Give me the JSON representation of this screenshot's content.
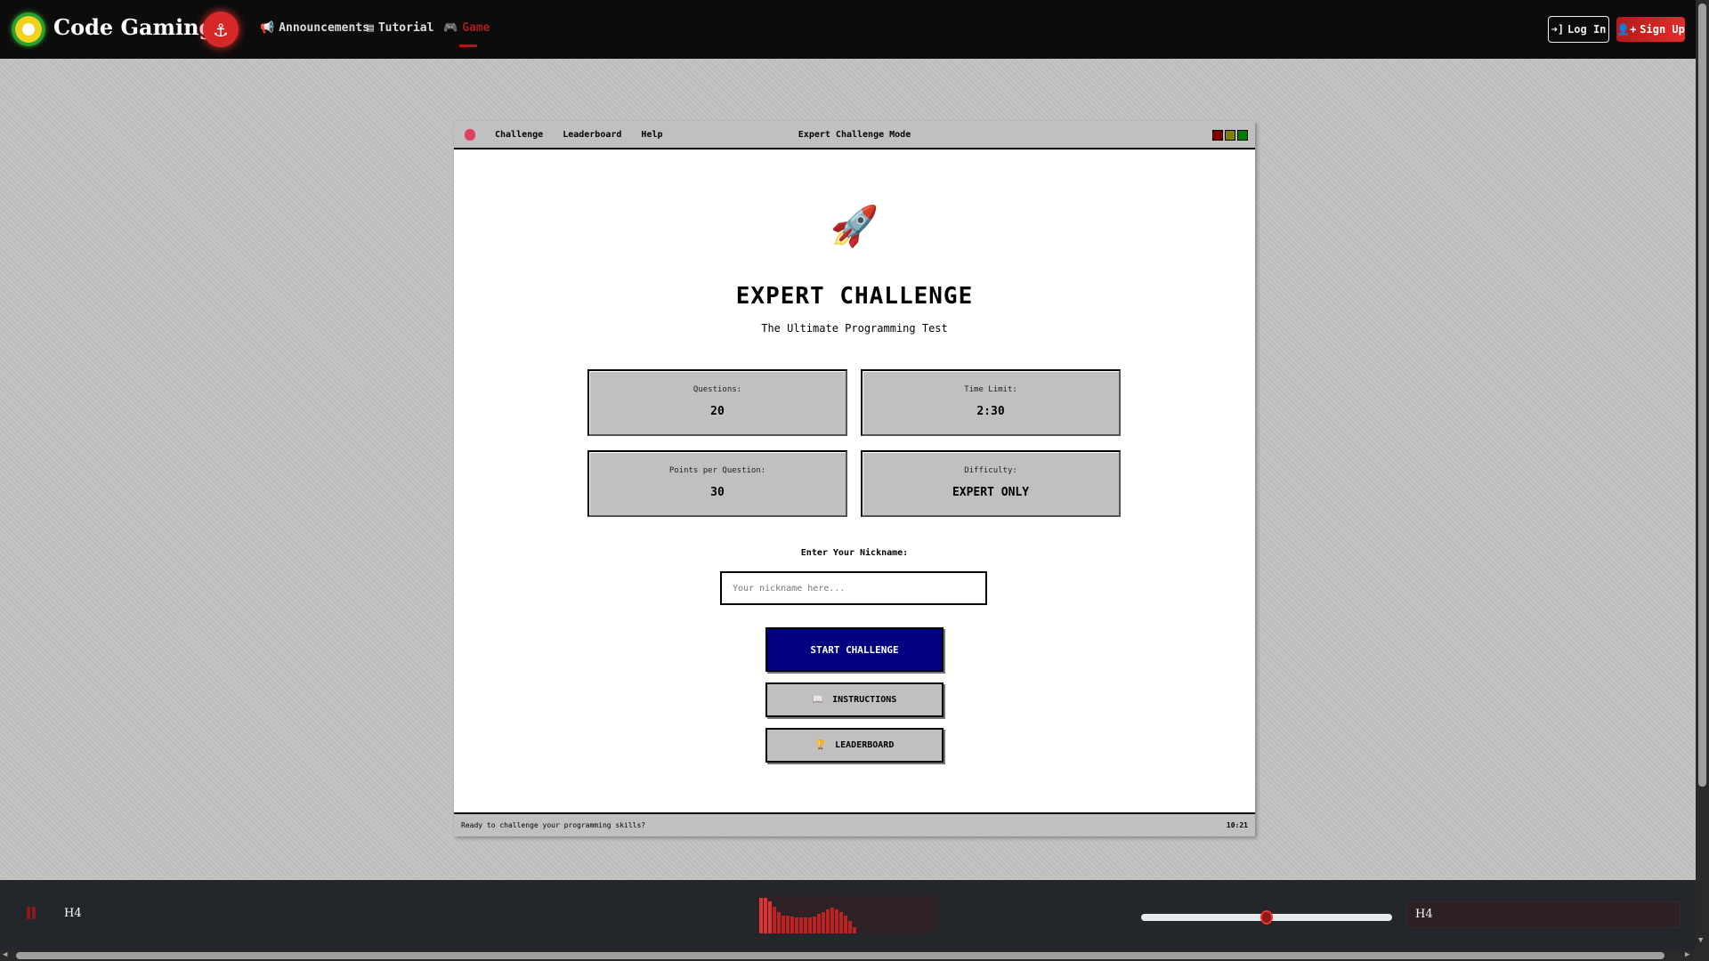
{
  "header": {
    "brand": "Code Gaming",
    "nav": [
      {
        "label": "Announcements",
        "icon": "megaphone-icon"
      },
      {
        "label": "Tutorial",
        "icon": "book-icon"
      },
      {
        "label": "Game",
        "icon": "gamepad-icon",
        "active": true
      }
    ],
    "login": "Log In",
    "signup": "Sign Up"
  },
  "window": {
    "menu": [
      "Challenge",
      "Leaderboard",
      "Help"
    ],
    "title": "Expert Challenge Mode",
    "controls_colors": [
      "#800000",
      "#808000",
      "#008000"
    ]
  },
  "main": {
    "icon": "🚀",
    "title": "EXPERT CHALLENGE",
    "subtitle": "The Ultimate Programming Test",
    "stats": [
      {
        "label": "Questions:",
        "value": "20"
      },
      {
        "label": "Time Limit:",
        "value": "2:30"
      },
      {
        "label": "Points per Question:",
        "value": "30"
      },
      {
        "label": "Difficulty:",
        "value": "EXPERT ONLY"
      }
    ],
    "nickname_label": "Enter Your Nickname:",
    "nickname_placeholder": "Your nickname here...",
    "nickname_value": "",
    "start": "START CHALLENGE",
    "instructions": "INSTRUCTIONS",
    "instructions_icon": "📖",
    "leaderboard": "LEADERBOARD",
    "leaderboard_icon": "🏆"
  },
  "status": {
    "message": "Ready to challenge your programming skills?",
    "time": "10:21"
  },
  "player": {
    "left_title": "H4",
    "right_title": "H4",
    "volume": 0.5,
    "visualizer": [
      100,
      100,
      90,
      75,
      60,
      50,
      50,
      48,
      45,
      45,
      45,
      45,
      48,
      55,
      60,
      68,
      72,
      68,
      60,
      50,
      35,
      18
    ]
  },
  "colors": {
    "accent": "#d62828",
    "start_bg": "#000080"
  }
}
